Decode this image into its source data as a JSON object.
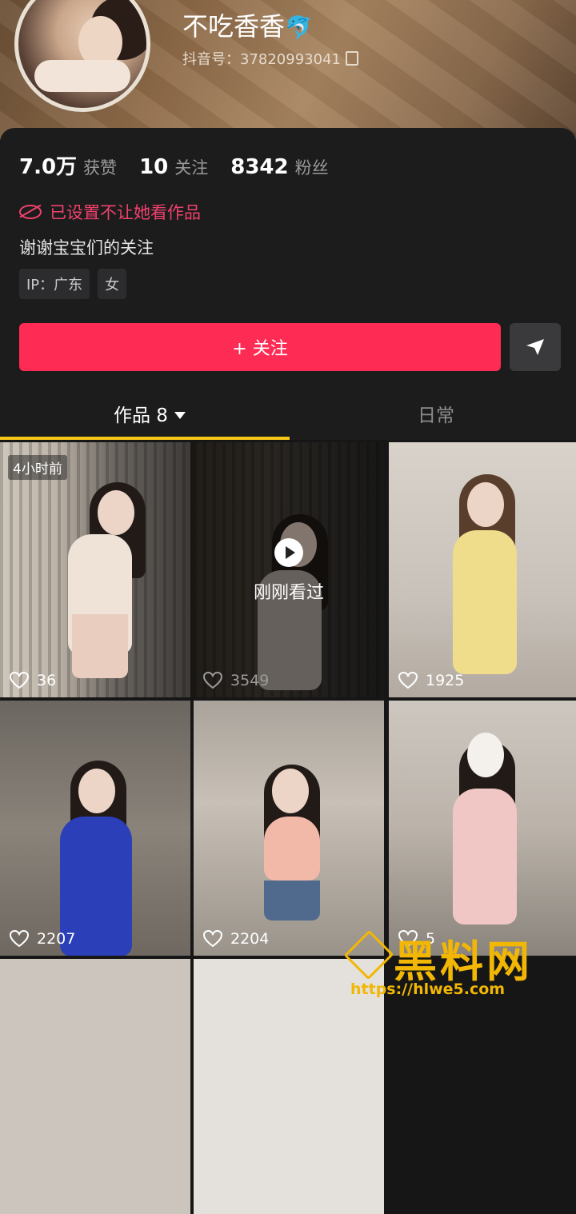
{
  "profile": {
    "nickname": "不吃香香",
    "nickname_emoji": "🐬",
    "douyin_id": "抖音号：37820993041"
  },
  "stats": [
    {
      "value": "7.0万",
      "label": "获赞"
    },
    {
      "value": "10",
      "label": "关注"
    },
    {
      "value": "8342",
      "label": "粉丝"
    }
  ],
  "notice": "已设置不让她看作品",
  "bio": "谢谢宝宝们的关注",
  "tags": [
    "IP：广东",
    "女"
  ],
  "actions": {
    "follow_label": "+ 关注"
  },
  "tabs": {
    "works_label": "作品 8",
    "daily_label": "日常"
  },
  "videos": [
    {
      "likes": "36",
      "badge": "4小时前"
    },
    {
      "likes": "3549",
      "status": "刚刚看过"
    },
    {
      "likes": "1925"
    },
    {
      "likes": "2207"
    },
    {
      "likes": "2204"
    },
    {
      "likes": "5"
    }
  ],
  "watermark": {
    "brand": "黑料网",
    "url": "https://hlwe5.com"
  },
  "colors": {
    "accent": "#fe2c55",
    "tab_indicator": "#f5c518",
    "notice": "#f0416b",
    "watermark": "#f2b705"
  }
}
